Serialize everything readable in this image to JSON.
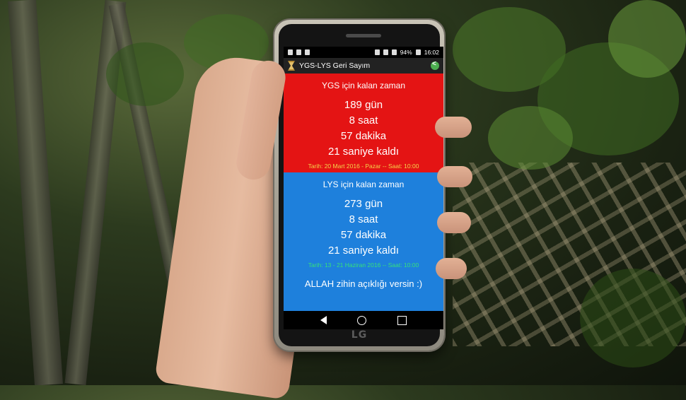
{
  "status_bar": {
    "battery": "94%",
    "time": "16:02"
  },
  "app": {
    "title": "YGS-LYS Geri Sayım"
  },
  "ygs": {
    "heading": "YGS için kalan zaman",
    "days": "189  gün",
    "hours": "8  saat",
    "minutes": "57 dakika",
    "seconds": "21 saniye kaldı",
    "date": "Tarih: 20 Mart 2016 - Pazar --  Saat: 10:00"
  },
  "lys": {
    "heading": "LYS için kalan zaman",
    "days": "273  gün",
    "hours": "8  saat",
    "minutes": "57 dakika",
    "seconds": "21 saniye kaldı",
    "date": "Tarih: 13 - 21 Haziran 2016 -- Saat: 10:00"
  },
  "motto": "ALLAH zihin açıklığı versin :)",
  "phone_brand": "LG",
  "colors": {
    "ygs_bg": "#e41414",
    "lys_bg": "#1e80dc",
    "ygs_date": "#f5d54a",
    "lys_date": "#36e07a"
  },
  "icons": [
    "hourglass-icon",
    "share-icon",
    "back-icon",
    "home-icon",
    "recent-apps-icon"
  ]
}
